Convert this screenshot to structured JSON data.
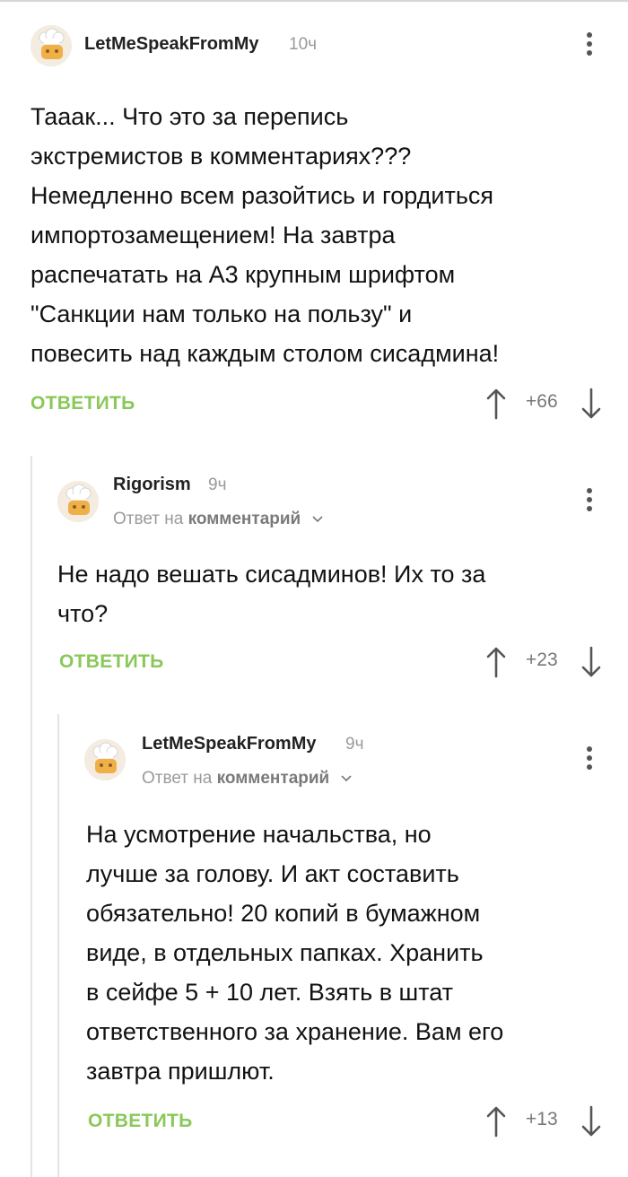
{
  "comments": [
    {
      "author": "LetMeSpeakFromMy",
      "time": "10ч",
      "reply_to": null,
      "text_lines": [
        "Тааак... Что это за перепись",
        "экстремистов в комментариях???",
        "Немедленно всем разойтись и гордиться",
        "импортозамещением! На завтра",
        "распечатать на А3 крупным шрифтом",
        "\"Санкции нам только на пользу\" и",
        "повесить над каждым столом сисадмина!"
      ],
      "reply_label": "ОТВЕТИТЬ",
      "score": "+66"
    },
    {
      "author": "Rigorism",
      "time": "9ч",
      "reply_to": {
        "prefix": "Ответ на",
        "target": "комментарий"
      },
      "text_lines": [
        "Не надо вешать сисадминов! Их то за",
        "что?"
      ],
      "reply_label": "ОТВЕТИТЬ",
      "score": "+23"
    },
    {
      "author": "LetMeSpeakFromMy",
      "time": "9ч",
      "reply_to": {
        "prefix": "Ответ на",
        "target": "комментарий"
      },
      "text_lines": [
        "На усмотрение начальства, но",
        "лучше за голову. И акт составить",
        "обязательно! 20 копий в бумажном",
        "виде, в отдельных папках. Хранить",
        "в сейфе 5 + 10 лет. Взять в штат",
        "ответственного за хранение. Вам его",
        "завтра пришлют."
      ],
      "reply_label": "ОТВЕТИТЬ",
      "score": "+13"
    }
  ],
  "icons": {
    "avatar": "chef-hat-avatar-icon",
    "menu": "kebab-menu-icon",
    "upvote": "arrow-up-icon",
    "downvote": "arrow-down-icon",
    "expand": "chevron-down-icon"
  },
  "colors": {
    "reply_button": "#8ac858",
    "meta_text": "#9a9a9a",
    "body_text": "#121212"
  }
}
